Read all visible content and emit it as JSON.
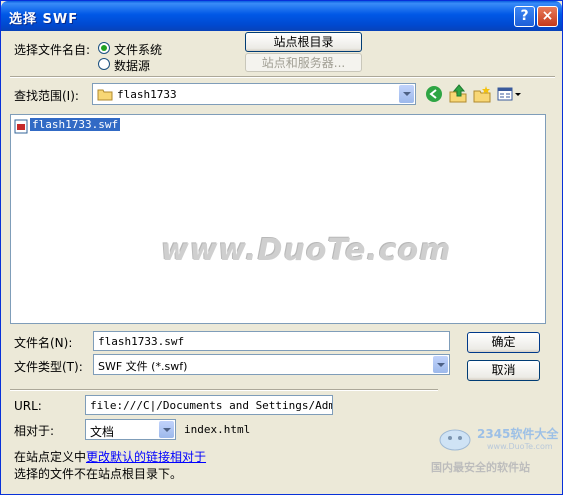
{
  "window": {
    "title": "选择 SWF",
    "help_label": "?",
    "close_label": "×"
  },
  "select_from": {
    "label": "选择文件名自:",
    "option_filesystem": "文件系统",
    "option_datasource": "数据源",
    "selected": "filesystem"
  },
  "buttons": {
    "site_root": "站点根目录",
    "site_server": "站点和服务器...",
    "ok": "确定",
    "cancel": "取消"
  },
  "lookin": {
    "label": "查找范围(I):",
    "value": "flash1733"
  },
  "files": [
    {
      "name": "flash1733.swf",
      "selected": true
    }
  ],
  "filename": {
    "label": "文件名(N):",
    "value": "flash1733.swf"
  },
  "filetype": {
    "label": "文件类型(T):",
    "value": "SWF 文件 (*.swf)"
  },
  "url": {
    "label": "URL:",
    "value": "file:///C|/Documents and Settings/Admini:"
  },
  "relative": {
    "label": "相对于:",
    "value": "文档",
    "page": "index.html"
  },
  "footer": {
    "line1_prefix": "在站点定义中",
    "line1_link": "更改默认的链接相对于",
    "line2": "选择的文件不在站点根目录下。"
  },
  "watermark": {
    "main": "www.DuoTe.com",
    "logo_text": "2345软件大全",
    "logo_url": "www.DuoTe.com",
    "logo_tagline": "国内最安全的软件站"
  },
  "colors": {
    "titlebar": "#0054E3",
    "selection": "#316AC5",
    "link": "#0000FF",
    "dialog_bg": "#ECE9D8"
  }
}
